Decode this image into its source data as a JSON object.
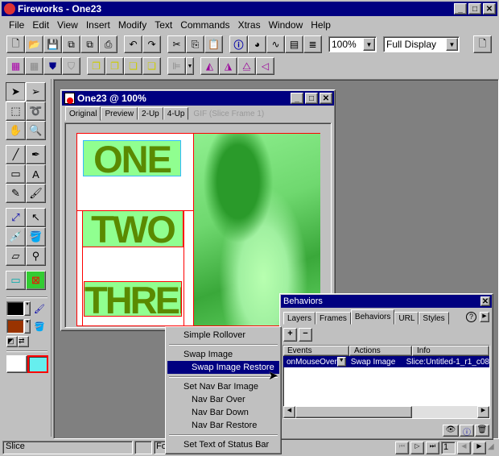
{
  "app": {
    "title": "Fireworks - One23"
  },
  "menubar": [
    "File",
    "Edit",
    "View",
    "Insert",
    "Modify",
    "Text",
    "Commands",
    "Xtras",
    "Window",
    "Help"
  ],
  "toolbar": {
    "zoom": "100%",
    "display": "Full Display"
  },
  "document": {
    "title": "One23 @  100%",
    "tabs": [
      "Original",
      "Preview",
      "2-Up",
      "4-Up"
    ],
    "format": "GIF (Slice Frame 1)",
    "words": [
      "ONE",
      "TWO",
      "THREE"
    ]
  },
  "behaviors": {
    "title": "Behaviors",
    "tabs": [
      "Layers",
      "Frames",
      "Behaviors",
      "URL",
      "Styles"
    ],
    "columns": [
      "Events",
      "Actions",
      "Info"
    ],
    "row": {
      "event": "onMouseOver",
      "action": "Swap Image",
      "info": "Slice:Untitled-1_r1_c08"
    }
  },
  "context_menu": {
    "items": [
      "Simple Rollover",
      "Swap Image",
      "Swap Image Restore",
      "Set Nav Bar Image",
      "Nav Bar Over",
      "Nav Bar Down",
      "Nav Bar Restore",
      "Set Text of Status Bar"
    ],
    "selected": "Swap Image Restore"
  },
  "status": {
    "text": "Slice",
    "partial": "Fo",
    "frame": "1"
  },
  "colors": {
    "title": "#000080",
    "canvas_text": "#5a8a00",
    "slice_fill": "#90ff90",
    "fill_swatch": "#993300",
    "stroke_swatch": "#000000"
  }
}
